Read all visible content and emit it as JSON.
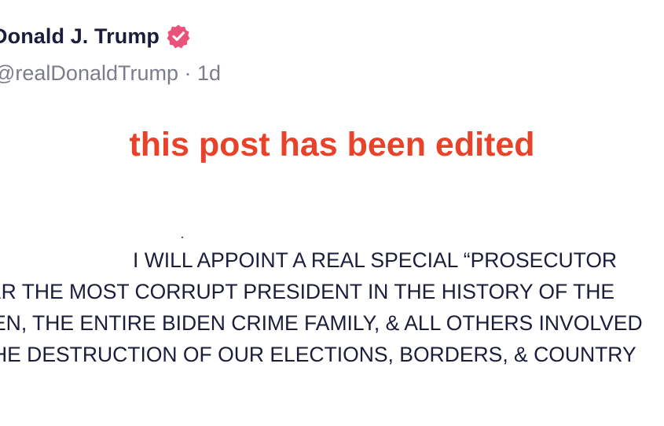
{
  "post": {
    "author_name": "Donald J. Trump",
    "handle": "@realDonaldTrump",
    "separator": "·",
    "time_ago": "1d",
    "verified_icon": "verified-badge-icon",
    "verified_color": "#e9527a",
    "edited_notice": "this post has been edited",
    "edited_notice_color": "#e8432a",
    "body_lines": [
      "I WILL APPOINT A REAL SPECIAL “PROSECUTOR",
      "ER THE MOST CORRUPT PRESIDENT IN THE HISTORY OF THE",
      "EN, THE ENTIRE BIDEN CRIME FAMILY, & ALL OTHERS INVOLVED",
      "HE DESTRUCTION OF OUR ELECTIONS, BORDERS, & COUNTRY"
    ]
  }
}
